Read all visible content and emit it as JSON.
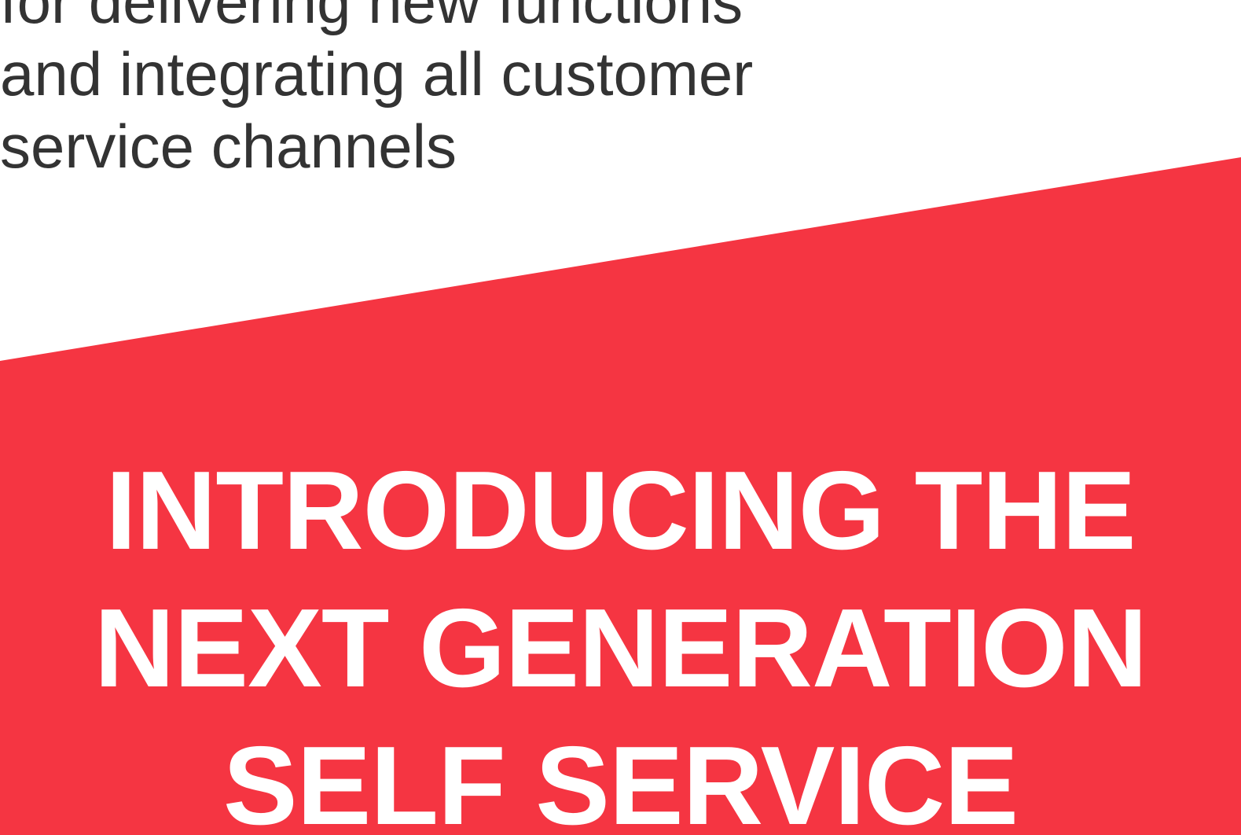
{
  "intro": {
    "lines": [
      "for delivering new functions",
      "and integrating all customer",
      "service channels"
    ]
  },
  "headline": {
    "lines": [
      "INTRODUCING THE",
      "NEXT GENERATION",
      "SELF SERVICE"
    ]
  },
  "colors": {
    "accent": "#f53542",
    "body_text": "#333333",
    "headline_text": "#ffffff",
    "background": "#ffffff"
  }
}
